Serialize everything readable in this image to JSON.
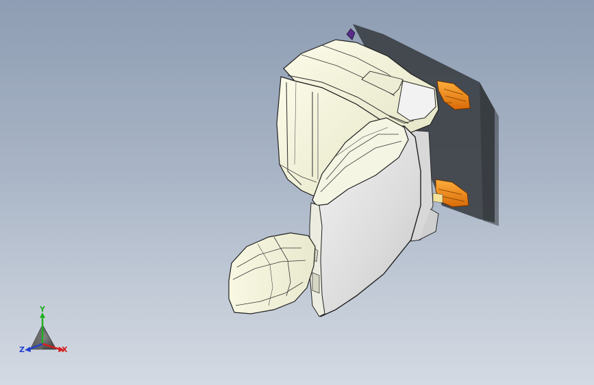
{
  "triad": {
    "y_label": "Y",
    "x_label": "X",
    "z_label": "Z"
  },
  "colors": {
    "background_top": "#8e9db3",
    "background_bottom": "#d4dae3",
    "seat_fabric": "#f1f1dc",
    "back_panel": "#e2e2e2",
    "bracket_orange": "#f08a1c",
    "shadow": "#3b3f45",
    "axis_x": "#d42020",
    "axis_y": "#20b020",
    "axis_z": "#2040d0"
  }
}
